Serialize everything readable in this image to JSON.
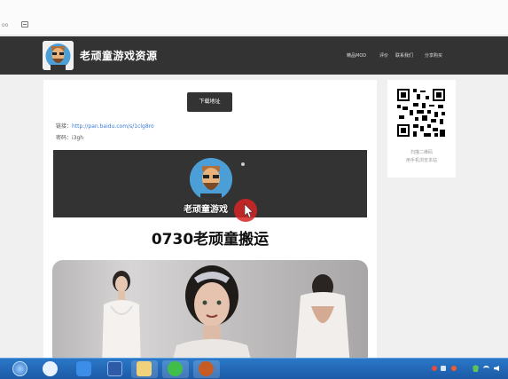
{
  "browser": {
    "left_text": "oo"
  },
  "header": {
    "site_title": "老顽童游戏资源",
    "nav": [
      "精品MOD",
      "评价",
      "联系我们",
      "分享购买"
    ]
  },
  "main": {
    "download_label": "下载地址",
    "link_label": "链接：",
    "link_url": "http://pan.baidu.com/s/1clg8ro",
    "password_label": "密码：i3gh",
    "banner_text": "老顽童游戏",
    "heading": "0730老顽童搬运"
  },
  "sidebar": {
    "qr_caption_1": "扫描二维码",
    "qr_caption_2": "用手机浏览本站"
  },
  "colors": {
    "header": "#333333",
    "accent_link": "#3a7bd5",
    "cursor": "#d82626",
    "taskbar": "#1c5aa6"
  }
}
